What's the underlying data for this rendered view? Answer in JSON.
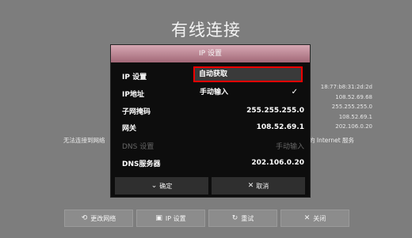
{
  "screen": {
    "title": "有线连接"
  },
  "background": {
    "right_values": [
      "18:77:b8:31:2d:2d",
      "108.52.69.68",
      "255.255.255.0",
      "108.52.69.1",
      "202.106.0.20"
    ],
    "status_left": "无法连接到网络",
    "status_right": "的 Internet 服务"
  },
  "dialog": {
    "header": "IP 设置",
    "rows": {
      "ip_setting": {
        "label": "IP 设置"
      },
      "ip_address": {
        "label": "IP地址"
      },
      "subnet": {
        "label": "子网掩码",
        "value": "255.255.255.0"
      },
      "gateway": {
        "label": "网关",
        "value": "108.52.69.1"
      },
      "dns_setting": {
        "label": "DNS 设置",
        "value": "手动输入"
      },
      "dns_server": {
        "label": "DNS服务器",
        "value": "202.106.0.20"
      }
    },
    "dropdown": {
      "selected": "自动获取",
      "option_manual": "手动输入"
    },
    "footer": {
      "ok": "确定",
      "cancel": "取消"
    }
  },
  "bottom_bar": {
    "change_network": "更改网络",
    "ip_settings": "IP 设置",
    "retry": "重试",
    "close": "关闭"
  }
}
